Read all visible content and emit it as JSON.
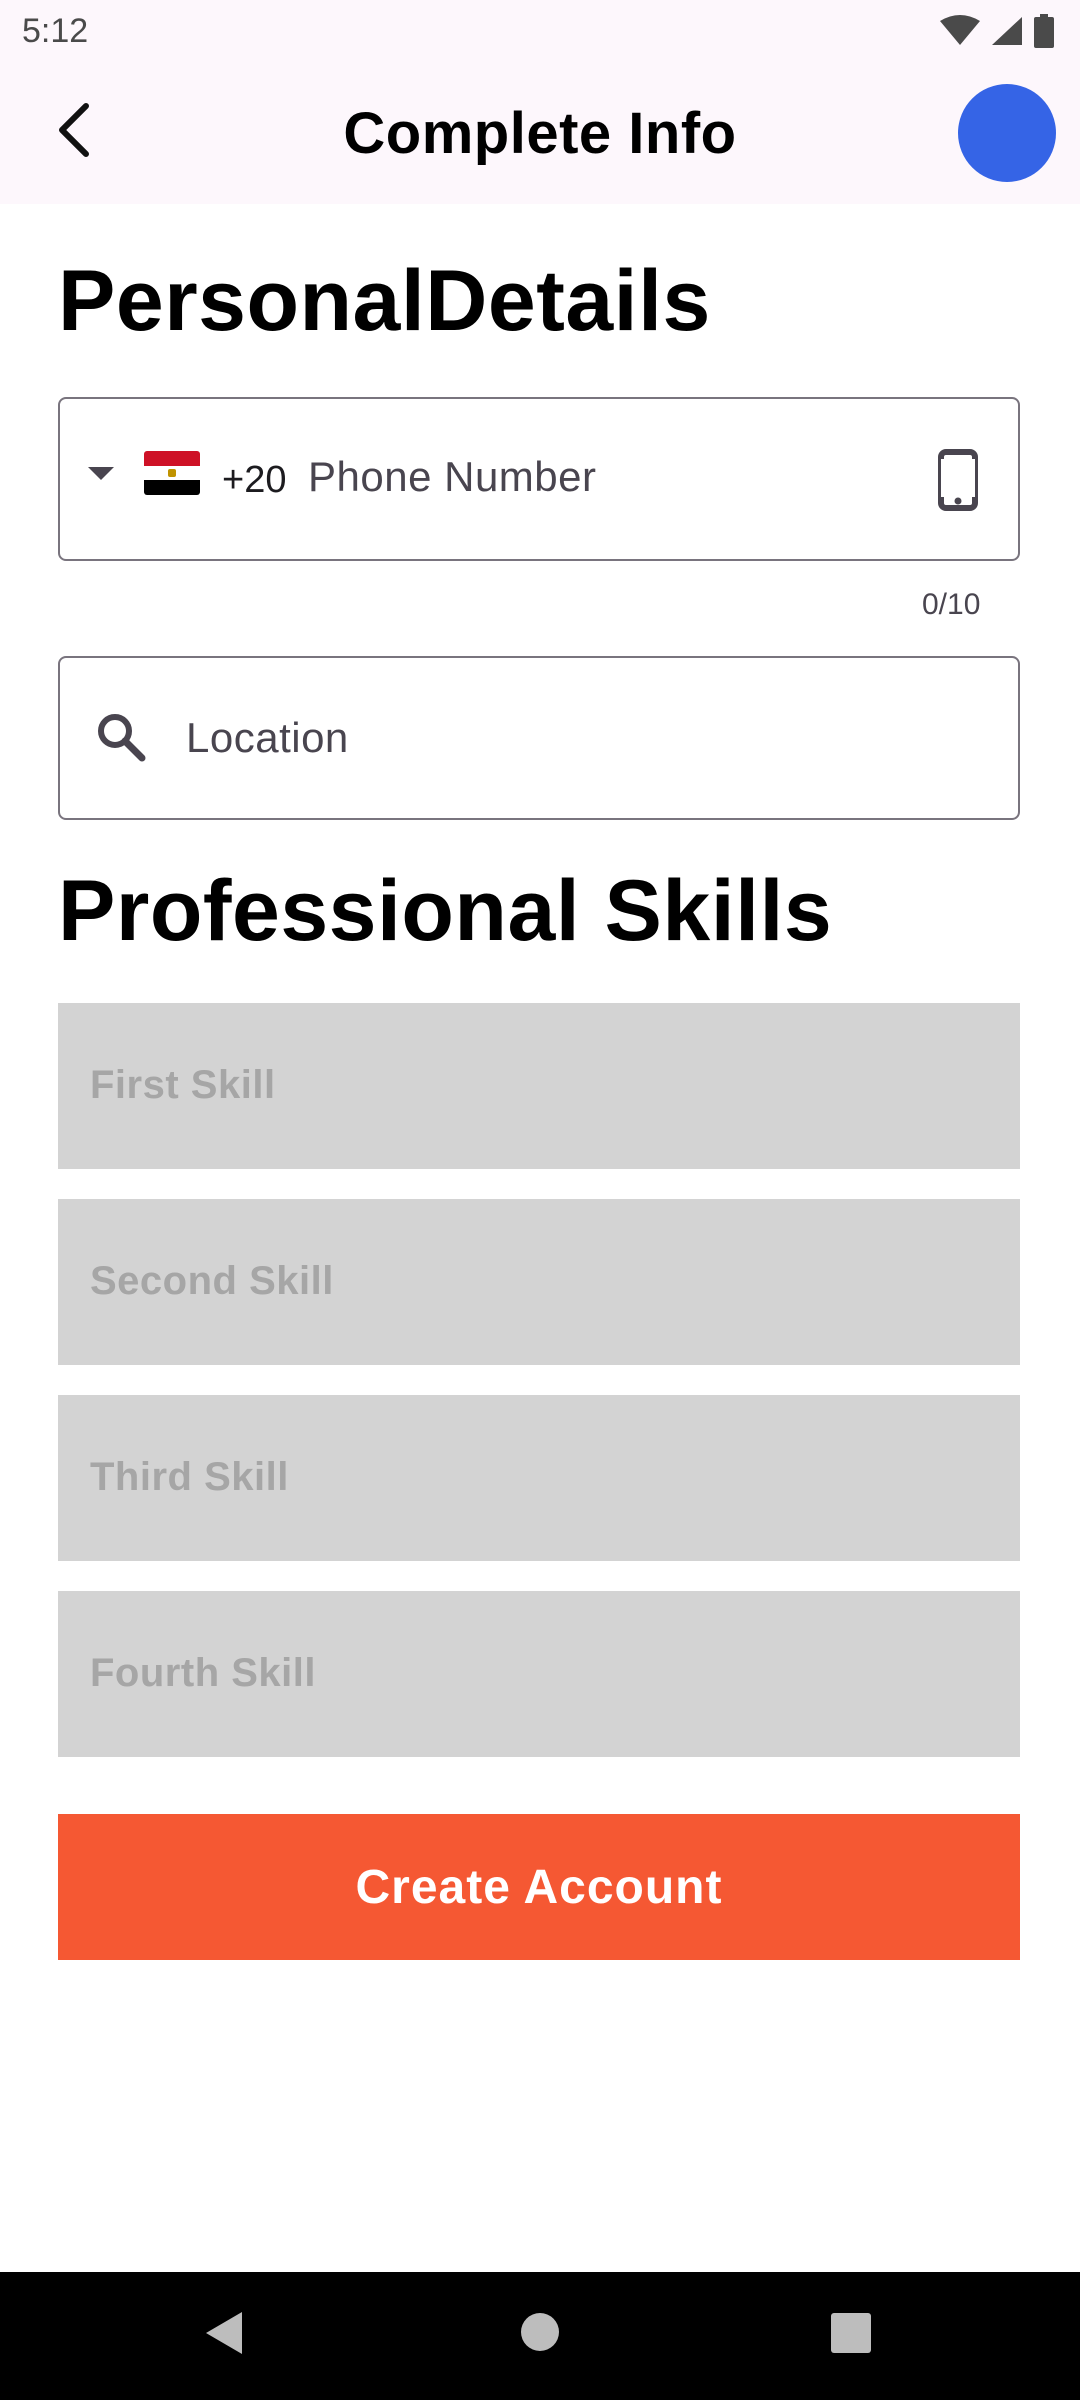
{
  "status": {
    "time": "5:12"
  },
  "header": {
    "title": "Complete Info"
  },
  "personal": {
    "title": "PersonalDetails",
    "dial_code": "+20",
    "phone_placeholder": "Phone Number",
    "counter": "0/10",
    "location_placeholder": "Location"
  },
  "skills": {
    "title": "Professional Skills",
    "items": [
      "First Skill",
      "Second Skill",
      "Third Skill",
      "Fourth Skill"
    ]
  },
  "actions": {
    "create_label": "Create Account"
  },
  "colors": {
    "accent": "#f55833",
    "avatar": "#3564e6",
    "field_bg": "#d3d3d3"
  }
}
